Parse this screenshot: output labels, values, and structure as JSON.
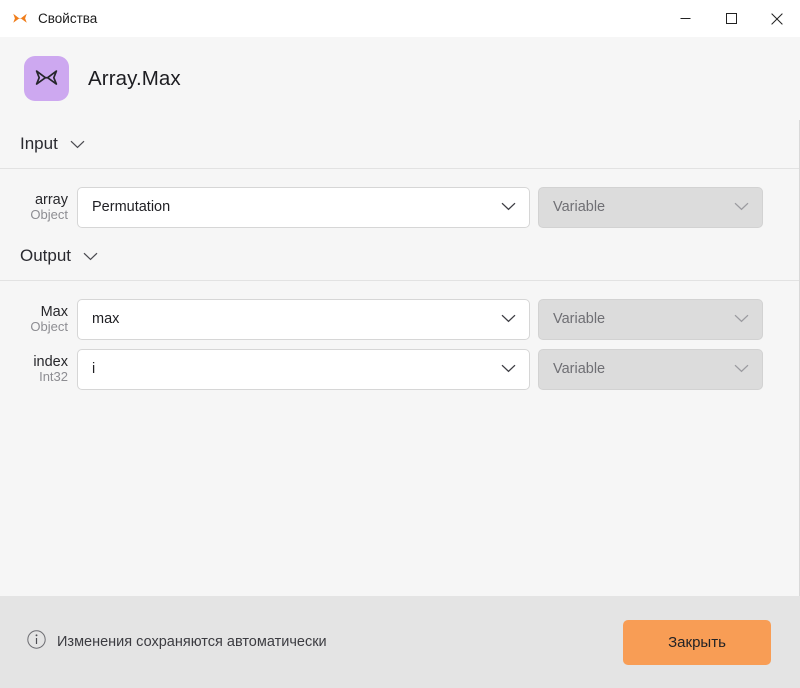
{
  "titlebar": {
    "title": "Свойства",
    "icon": "butterfly-icon",
    "minimize_label": "—",
    "maximize_label": "▢",
    "close_label": "✕"
  },
  "header": {
    "app_title": "Array.Max",
    "icon": "butterfly-icon",
    "icon_bg": "#cda8f0"
  },
  "sections": [
    {
      "id": "input",
      "title": "Input",
      "collapse_icon": "chevron-down-icon",
      "rows": [
        {
          "name": "array",
          "type": "Object",
          "value": "Permutation",
          "value_icon": "chevron-down-icon",
          "binding": "Variable",
          "binding_icon": "chevron-down-icon",
          "binding_disabled": true
        }
      ]
    },
    {
      "id": "output",
      "title": "Output",
      "collapse_icon": "chevron-down-icon",
      "rows": [
        {
          "name": "Max",
          "type": "Object",
          "value": "max",
          "value_icon": "chevron-down-icon",
          "binding": "Variable",
          "binding_icon": "chevron-down-icon",
          "binding_disabled": true
        },
        {
          "name": "index",
          "type": "Int32",
          "value": "i",
          "value_icon": "chevron-down-icon",
          "binding": "Variable",
          "binding_icon": "chevron-down-icon",
          "binding_disabled": true
        }
      ]
    }
  ],
  "footer": {
    "info_icon": "info-circle-icon",
    "note": "Изменения сохраняются автоматически",
    "close_label": "Закрыть",
    "close_color": "#f89d55"
  }
}
